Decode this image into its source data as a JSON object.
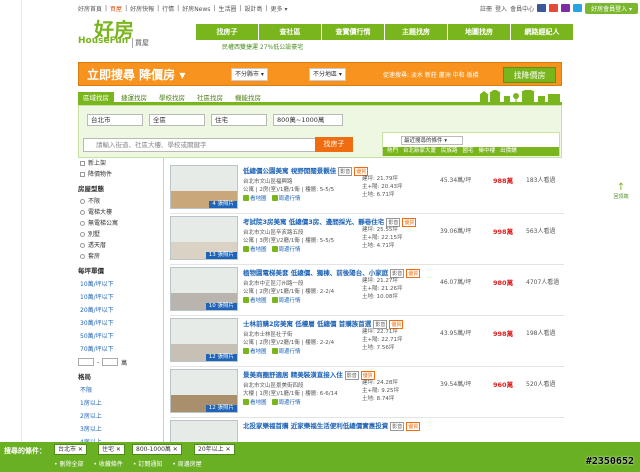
{
  "topbar": {
    "links": [
      "好房首頁",
      "買屋",
      "好房快報",
      "行情",
      "好房News",
      "生活圈",
      "設計島",
      "更多 ▾"
    ],
    "right_links": [
      "註冊",
      "登入",
      "會員中心"
    ],
    "user_button": "好房會員登入 ▾"
  },
  "logo": {
    "big": "好房",
    "sub": "HouseFun",
    "sub2": "買屋"
  },
  "main_nav": [
    "找房子",
    "查社區",
    "查實價行情",
    "主題找房",
    "地圖找房",
    "網路經紀人"
  ],
  "subnav_note": "民權西雙捷運 27%低公設豪宅",
  "banner": {
    "title": "立即搜尋 降價房 ▾",
    "dropdown1": "不分縣市 ▾",
    "dropdown2": "不分地區 ▾",
    "hot": "促速搜尋: 淡水 新莊 蘆洲 中和 板橋",
    "button": "找降價房"
  },
  "tabs": [
    "區域找房",
    "捷運找房",
    "學校找房",
    "社區找房",
    "機能找房"
  ],
  "search": {
    "city": "台北市",
    "district": "全區",
    "type": "住宅",
    "price": "800萬~1000萬",
    "placeholder": "請輸入街道、社區大樓、學校或關鍵字",
    "button": "找房子",
    "hot_label": "最近搜尋的條件 ▾",
    "hot_tags": [
      "熱門",
      "台北新家大廈",
      "民族路",
      "國宅",
      "欒中樓",
      "出價鋪"
    ]
  },
  "sidebar": {
    "checks": [
      "新上架",
      "降價物件"
    ],
    "type_head": "房屋型態",
    "types": [
      "不限",
      "電梯大樓",
      "無電梯公寓",
      "別墅",
      "透天厝",
      "套房"
    ],
    "price_head": "每坪單價",
    "prices": [
      "10萬/坪以下",
      "10萬/坪以下",
      "20萬/坪以下",
      "30萬/坪以下",
      "50萬/坪以下",
      "70萬/坪以下"
    ],
    "range_unit": "萬",
    "floor_head": "格局",
    "floors": [
      "不限",
      "1房以上",
      "2房以上",
      "3房以上",
      "4房以上"
    ]
  },
  "listings": [
    {
      "title": "低總價公園美寓 視野開闊景觀佳",
      "tags": [
        "影音",
        "優質"
      ],
      "addr": "台北市文山區福興路",
      "spec": "公寓 | 2房(室)/1廳/1衛 | 樓層: 5-5/5",
      "land": "建坪: 21.79坪",
      "main": "主+陽: 20.43坪",
      "ratio": "土地: 6.71坪",
      "unit": "45.34萬/坪",
      "price": "988萬",
      "views": "183人看過",
      "photos": "4 張照片"
    },
    {
      "title": "考試院3房美寓 低總價3房、邊間採光、靜巷住宅",
      "tags": [
        "影音",
        "優質"
      ],
      "addr": "台北市文山區辛亥路五段",
      "spec": "公寓 | 3房(室)/2廳/1衛 | 樓層: 5-5/5",
      "land": "建坪: 25.55坪",
      "main": "主+陽: 22.15坪",
      "ratio": "土地: 4.71坪",
      "unit": "39.06萬/坪",
      "price": "998萬",
      "views": "563人看過",
      "photos": "13 張照片"
    },
    {
      "title": "植物園電梯美套 低總價、獨棟、前後陽台、小家庭",
      "tags": [
        "影音",
        "優質"
      ],
      "addr": "台北市中正區汀州路一段",
      "spec": "公寓 | 2房(室)/1廳/1衛 | 樓層: 2-2/4",
      "land": "建坪: 21.27坪",
      "main": "主+陽: 21.26坪",
      "ratio": "土地: 10.08坪",
      "unit": "46.07萬/坪",
      "price": "980萬",
      "views": "4707人看過",
      "photos": "10 張照片"
    },
    {
      "title": "士林前購2房美寓 低樓層 低總價 首購族首選",
      "tags": [
        "影音",
        "優質"
      ],
      "addr": "台北市士林區社子街",
      "spec": "公寓 | 2房(室)/2廳/1衛 | 樓層: 2-2/4",
      "land": "建坪: 22.71坪",
      "main": "主+陽: 22.71坪",
      "ratio": "土地: 7.56坪",
      "unit": "43.95萬/坪",
      "price": "998萬",
      "views": "198人看過",
      "photos": "12 張照片"
    },
    {
      "title": "景美商圈舒適居 精美裝潢直接入住",
      "tags": [
        "影音",
        "優質"
      ],
      "addr": "台北市文山區景美街四段",
      "spec": "大樓 | 1房(室)/1廳/1衛 | 樓層: 6-6/14",
      "land": "建坪: 24.28坪",
      "main": "主+陽: 9.25坪",
      "ratio": "土地: 8.74坪",
      "unit": "39.54萬/坪",
      "price": "960萬",
      "views": "520人看過",
      "photos": "12 張照片"
    },
    {
      "title": "北投家樂福首購 近家樂福生活便利低總價實惠投資",
      "tags": [
        "影音",
        "優質"
      ],
      "addr": "",
      "spec": "",
      "land": "",
      "main": "",
      "ratio": "",
      "unit": "",
      "price": "",
      "views": "",
      "photos": ""
    }
  ],
  "listing_link1": "看地圖",
  "listing_link2": "周邊行情",
  "up_button": {
    "arrow": "↑",
    "label": "回頂端"
  },
  "bottom": {
    "label": "搜尋的條件：",
    "chips": [
      "台北市",
      "住宅",
      "800-1000萬",
      "20年以上"
    ],
    "links": [
      "• 刪除全部",
      "• 收藏條件",
      "• 訂閱通知",
      "• 周邊房屋"
    ]
  },
  "watermark": "#2350652"
}
